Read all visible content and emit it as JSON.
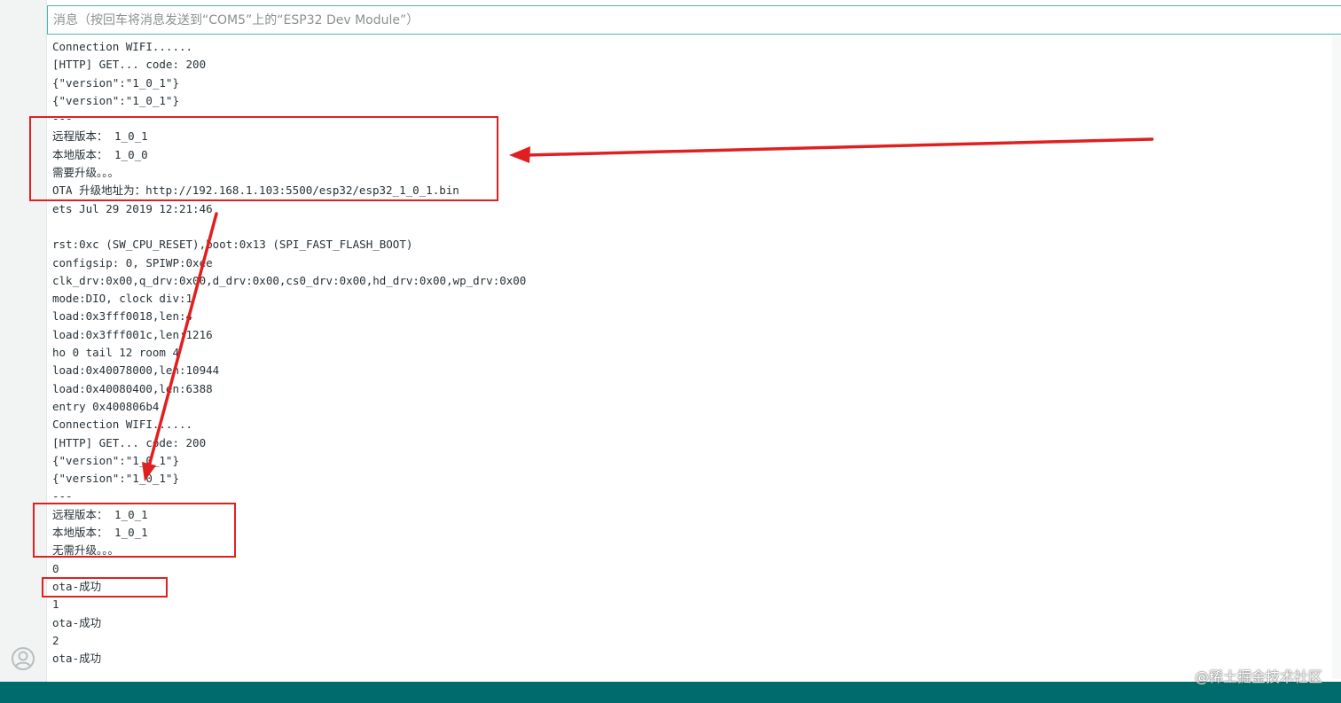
{
  "input": {
    "placeholder": "消息（按回车将消息发送到“COM5”上的“ESP32 Dev Module”）"
  },
  "serial_lines": [
    "Connection WIFI......",
    "[HTTP] GET... code: 200",
    "{\"version\":\"1_0_1\"}",
    "{\"version\":\"1_0_1\"}",
    "---",
    "远程版本： 1_0_1",
    "本地版本： 1_0_0",
    "需要升级。。。",
    "OTA 升级地址为：http://192.168.1.103:5500/esp32/esp32_1_0_1.bin",
    "ets Jul 29 2019 12:21:46",
    "",
    "rst:0xc (SW_CPU_RESET),boot:0x13 (SPI_FAST_FLASH_BOOT)",
    "configsip: 0, SPIWP:0xee",
    "clk_drv:0x00,q_drv:0x00,d_drv:0x00,cs0_drv:0x00,hd_drv:0x00,wp_drv:0x00",
    "mode:DIO, clock div:1",
    "load:0x3fff0018,len:4",
    "load:0x3fff001c,len:1216",
    "ho 0 tail 12 room 4",
    "load:0x40078000,len:10944",
    "load:0x40080400,len:6388",
    "entry 0x400806b4",
    "Connection WIFI......",
    "[HTTP] GET... code: 200",
    "{\"version\":\"1_0_1\"}",
    "{\"version\":\"1_0_1\"}",
    "---",
    "远程版本： 1_0_1",
    "本地版本： 1_0_1",
    "无需升级。。。",
    "0",
    "ota-成功",
    "1",
    "ota-成功",
    "2",
    "ota-成功"
  ],
  "watermark": "@稀土掘金技术社区",
  "colors": {
    "annotation": "#e02020",
    "status_bar": "#006b6d",
    "input_border": "#4db7b1"
  },
  "icons": {
    "account": "account-icon"
  }
}
